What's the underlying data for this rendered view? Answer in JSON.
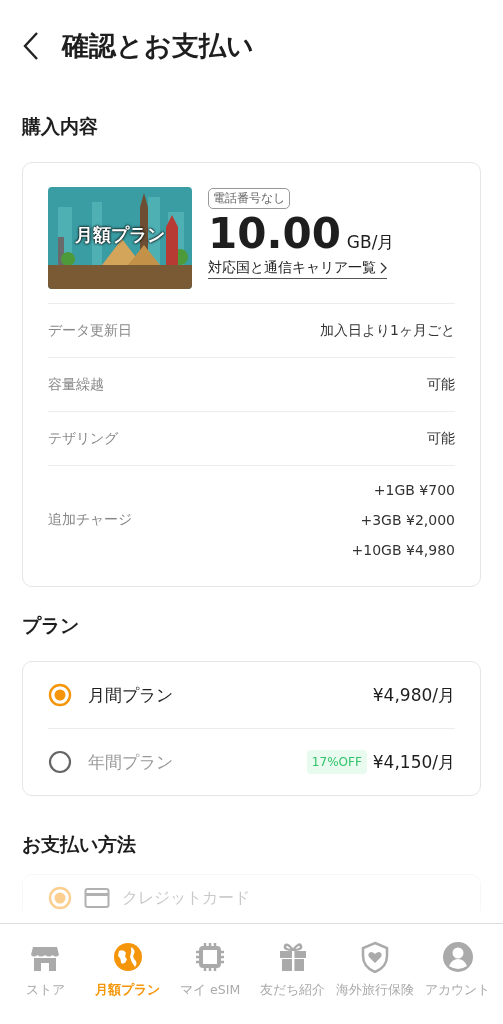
{
  "header": {
    "title": "確認とお支払い"
  },
  "purchase": {
    "heading": "購入内容",
    "image_label": "月額プラン",
    "badge": "電話番号なし",
    "amount": "10.00",
    "unit": "GB/月",
    "link": "対応国と通信キャリア一覧",
    "rows": [
      {
        "label": "データ更新日",
        "values": [
          "加入日より1ヶ月ごと"
        ]
      },
      {
        "label": "容量繰越",
        "values": [
          "可能"
        ]
      },
      {
        "label": "テザリング",
        "values": [
          "可能"
        ]
      },
      {
        "label": "追加チャージ",
        "values": [
          "+1GB ¥700",
          "+3GB ¥2,000",
          "+10GB ¥4,980"
        ]
      }
    ]
  },
  "plan": {
    "heading": "プラン",
    "options": [
      {
        "label": "月間プラン",
        "price": "¥4,980/月",
        "selected": true
      },
      {
        "label": "年間プラン",
        "badge": "17%OFF",
        "price": "¥4,150/月",
        "selected": false
      }
    ]
  },
  "payment": {
    "heading": "お支払い方法",
    "methods": [
      {
        "label": "クレジットカード",
        "selected": true
      }
    ]
  },
  "tab_bar": {
    "items": [
      {
        "label": "ストア",
        "selected": false
      },
      {
        "label": "月額プラン",
        "selected": true
      },
      {
        "label": "マイ eSIM",
        "selected": false
      },
      {
        "label": "友だち紹介",
        "selected": false
      },
      {
        "label": "海外旅行保険",
        "selected": false
      },
      {
        "label": "アカウント",
        "selected": false
      }
    ]
  }
}
